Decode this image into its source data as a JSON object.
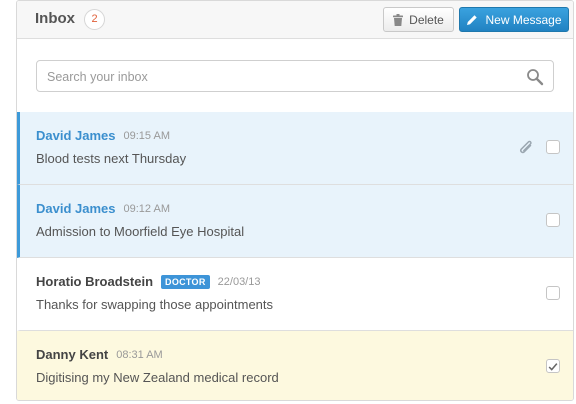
{
  "header": {
    "title": "Inbox",
    "unread_count": "2",
    "delete_label": "Delete",
    "new_message_label": "New Message"
  },
  "search": {
    "placeholder": "Search your inbox",
    "value": ""
  },
  "messages": [
    {
      "sender": "David James",
      "time": "09:15 AM",
      "tag": "",
      "subject": "Blood tests next Thursday",
      "state": "unread",
      "has_attachment": true,
      "checked": false
    },
    {
      "sender": "David James",
      "time": "09:12 AM",
      "tag": "",
      "subject": "Admission to Moorfield Eye Hospital",
      "state": "unread",
      "has_attachment": false,
      "checked": false
    },
    {
      "sender": "Horatio Broadstein",
      "time": "22/03/13",
      "tag": "DOCTOR",
      "subject": "Thanks for swapping those appointments",
      "state": "read",
      "has_attachment": false,
      "checked": false
    },
    {
      "sender": "Danny Kent",
      "time": "08:31 AM",
      "tag": "",
      "subject": "Digitising my New Zealand medical record",
      "state": "selected",
      "has_attachment": false,
      "checked": true
    }
  ],
  "colors": {
    "accent": "#3d9ad9",
    "unread_bg": "#e8f3fb",
    "selected_bg": "#fdf9df",
    "count_text": "#e0603a"
  }
}
